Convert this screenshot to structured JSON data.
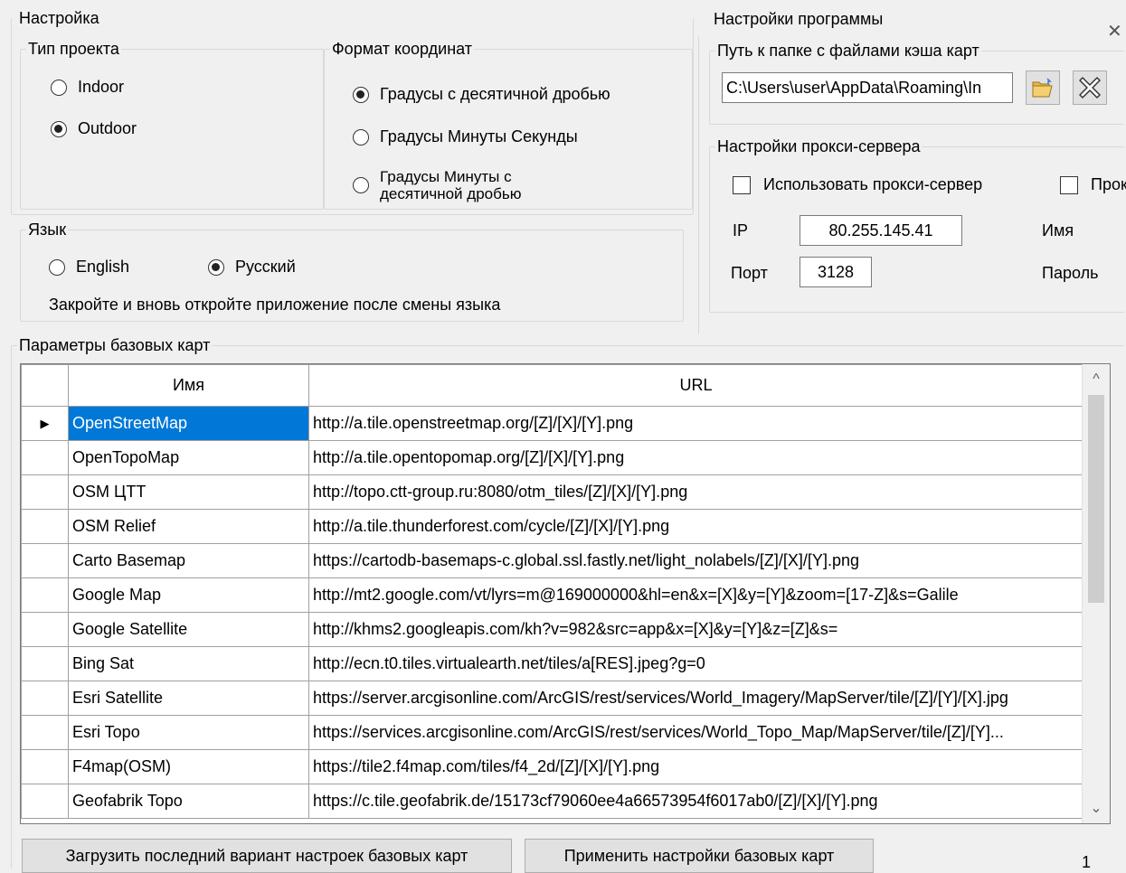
{
  "settings": {
    "title": "Настройка",
    "project_type": {
      "title": "Тип проекта",
      "options": [
        {
          "label": "Indoor",
          "selected": false
        },
        {
          "label": "Outdoor",
          "selected": true
        }
      ]
    },
    "coord_format": {
      "title": "Формат координат",
      "options": [
        {
          "label": "Градусы с десятичной дробью",
          "selected": true
        },
        {
          "label": "Градусы Минуты Секунды",
          "selected": false
        },
        {
          "label_line1": "Градусы Минуты с",
          "label_line2": "десятичной дробью",
          "selected": false
        }
      ]
    },
    "language": {
      "title": "Язык",
      "options": [
        {
          "label": "English",
          "selected": false
        },
        {
          "label": "Русский",
          "selected": true
        }
      ],
      "note": "Закройте и вновь откройте приложение после смены языка"
    }
  },
  "program": {
    "title": "Настройки программы",
    "close_glyph": "✕",
    "cache": {
      "title": "Путь к папке с файлами кэша карт",
      "path_value": "C:\\Users\\user\\AppData\\Roaming\\In"
    },
    "proxy": {
      "title": "Настройки прокси-сервера",
      "use_proxy_label": "Использовать прокси-сервер",
      "second_check_label": "Прок",
      "ip_label": "IP",
      "ip_value": "80.255.145.41",
      "port_label": "Порт",
      "port_value": "3128",
      "name_label": "Имя",
      "password_label": "Пароль"
    }
  },
  "basemaps": {
    "title": "Параметры базовых карт",
    "columns": [
      "Имя",
      "URL"
    ],
    "rows": [
      {
        "name": "OpenStreetMap",
        "url": "http://a.tile.openstreetmap.org/[Z]/[X]/[Y].png"
      },
      {
        "name": "OpenTopoMap",
        "url": "http://a.tile.opentopomap.org/[Z]/[X]/[Y].png"
      },
      {
        "name": "OSM ЦТТ",
        "url": "http://topo.ctt-group.ru:8080/otm_tiles/[Z]/[X]/[Y].png"
      },
      {
        "name": "OSM Relief",
        "url": "http://a.tile.thunderforest.com/cycle/[Z]/[X]/[Y].png"
      },
      {
        "name": "Carto Basemap",
        "url": "https://cartodb-basemaps-c.global.ssl.fastly.net/light_nolabels/[Z]/[X]/[Y].png"
      },
      {
        "name": "Google Map",
        "url": "http://mt2.google.com/vt/lyrs=m@169000000&hl=en&x=[X]&y=[Y]&zoom=[17-Z]&s=Galile"
      },
      {
        "name": "Google Satellite",
        "url": "http://khms2.googleapis.com/kh?v=982&src=app&x=[X]&y=[Y]&z=[Z]&s="
      },
      {
        "name": "Bing Sat",
        "url": "http://ecn.t0.tiles.virtualearth.net/tiles/a[RES].jpeg?g=0"
      },
      {
        "name": "Esri Satellite",
        "url": "https://server.arcgisonline.com/ArcGIS/rest/services/World_Imagery/MapServer/tile/[Z]/[Y]/[X].jpg"
      },
      {
        "name": "Esri Topo",
        "url": "https://services.arcgisonline.com/ArcGIS/rest/services/World_Topo_Map/MapServer/tile/[Z]/[Y]..."
      },
      {
        "name": "F4map(OSM)",
        "url": "https://tile2.f4map.com/tiles/f4_2d/[Z]/[X]/[Y].png"
      },
      {
        "name": "Geofabrik Topo",
        "url": "https://c.tile.geofabrik.de/15173cf79060ee4a66573954f6017ab0/[Z]/[X]/[Y].png"
      }
    ],
    "current_row_glyph": "▶",
    "scroll_up": "^",
    "scroll_down": "⌄",
    "load_button": "Загрузить последний вариант настроек базовых карт",
    "apply_button": "Применить настройки базовых карт",
    "page_indicator": "1"
  }
}
